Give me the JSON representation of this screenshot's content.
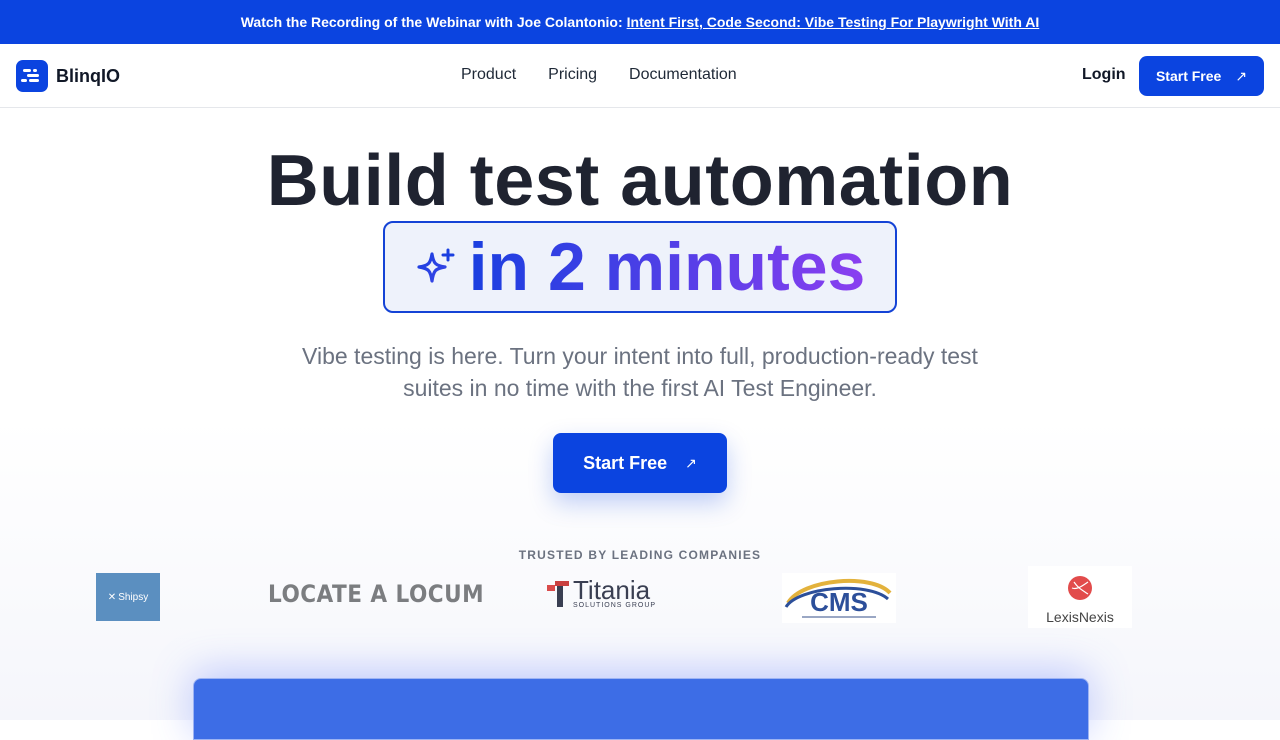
{
  "banner": {
    "text": "Watch the Recording of the Webinar with Joe Colantonio:",
    "link": "Intent First, Code Second: Vibe Testing For Playwright With AI"
  },
  "nav": {
    "brand": "BlinqIO",
    "links": [
      "Product",
      "Pricing",
      "Documentation"
    ],
    "login": "Login",
    "cta": "Start Free",
    "cta_icon": "arrow-up-right-icon"
  },
  "hero": {
    "title": "Build test automation",
    "highlight": "in 2 minutes",
    "highlight_icon": "sparkle-icon",
    "subtitle": "Vibe testing is here. Turn your intent into full, production-ready test suites in no time with the first AI Test Engineer.",
    "cta": "Start Free"
  },
  "trusted": {
    "heading": "TRUSTED BY LEADING COMPANIES",
    "logos": [
      "Shipsy",
      "LOCATE A LOCUM",
      "Titania",
      "SOLUTIONS GROUP",
      "CMS",
      "LexisNexis"
    ]
  },
  "colors": {
    "brand": "#0b44e0",
    "gradient_start": "#1a3fe0",
    "gradient_end": "#8a3ff0"
  }
}
